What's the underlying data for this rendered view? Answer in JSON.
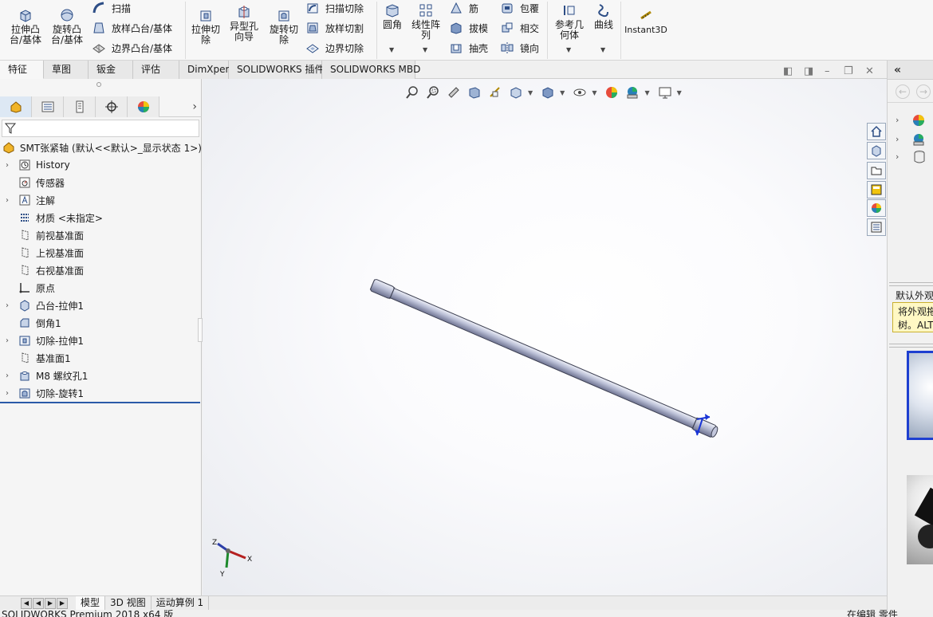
{
  "ribbon": {
    "extrude_boss": "拉伸凸台/基体",
    "revolve_boss": "旋转凸台/基体",
    "sweep": "扫描",
    "loft_boss": "放样凸台/基体",
    "boundary_boss": "边界凸台/基体",
    "extrude_cut": "拉伸切除",
    "hole_wizard": "异型孔向导",
    "revolve_cut": "旋转切除",
    "sweep_cut": "扫描切除",
    "loft_cut": "放样切割",
    "boundary_cut": "边界切除",
    "fillet": "圆角",
    "linear_pattern": "线性阵列",
    "rib": "筋",
    "draft": "拔模",
    "shell": "抽壳",
    "wrap": "包覆",
    "intersect": "相交",
    "mirror": "镜向",
    "ref_geometry": "参考几何体",
    "curves": "曲线",
    "instant3d": "Instant3D"
  },
  "tabs": [
    "特征",
    "草图",
    "钣金",
    "评估",
    "DimXpert",
    "SOLIDWORKS 插件",
    "SOLIDWORKS MBD"
  ],
  "tree": {
    "root": "SMT张紧轴 (默认<<默认>_显示状态 1>)",
    "items": [
      {
        "label": "History",
        "expandable": true
      },
      {
        "label": "传感器",
        "expandable": false
      },
      {
        "label": "注解",
        "expandable": true
      },
      {
        "label": "材质 <未指定>",
        "expandable": false
      },
      {
        "label": "前视基准面",
        "expandable": false
      },
      {
        "label": "上视基准面",
        "expandable": false
      },
      {
        "label": "右视基准面",
        "expandable": false
      },
      {
        "label": "原点",
        "expandable": false
      },
      {
        "label": "凸台-拉伸1",
        "expandable": true
      },
      {
        "label": "倒角1",
        "expandable": false
      },
      {
        "label": "切除-拉伸1",
        "expandable": true
      },
      {
        "label": "基准面1",
        "expandable": false
      },
      {
        "label": "M8 螺纹孔1",
        "expandable": true
      },
      {
        "label": "切除-旋转1",
        "expandable": true
      }
    ]
  },
  "triad": {
    "x": "X",
    "y": "Y",
    "z": "Z"
  },
  "right_pane": {
    "appearance_title": "默认外观",
    "tooltip_line1": "将外观拖",
    "tooltip_line2": "树。ALT"
  },
  "bottom_tabs": [
    "模型",
    "3D 视图",
    "运动算例 1"
  ],
  "status": {
    "left": "SOLIDWORKS Premium 2018 x64 版",
    "right": "在编辑 零件"
  },
  "colors": {
    "accent": "#2b5aa8",
    "part": "#c9cde0",
    "tooltip_bg": "#fff8c4"
  }
}
